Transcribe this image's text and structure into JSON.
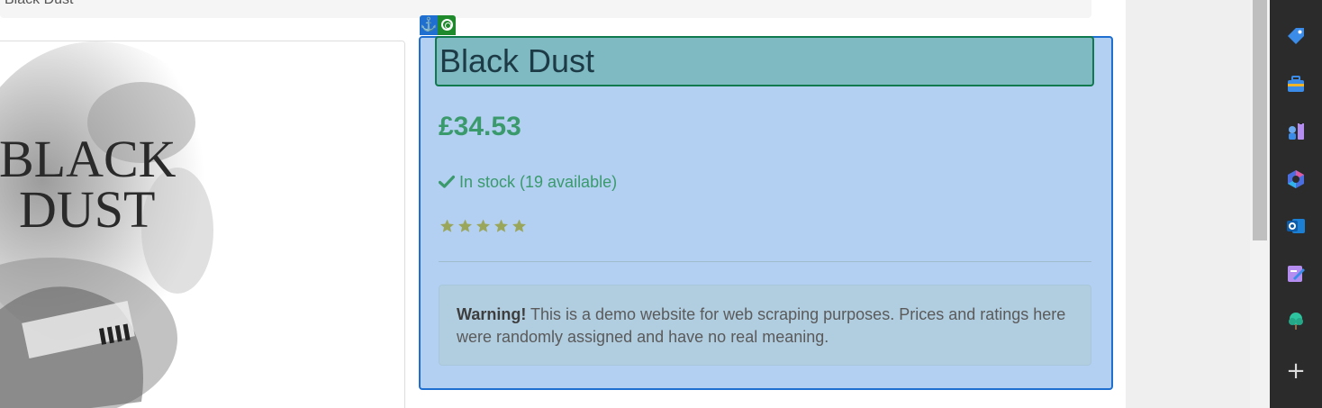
{
  "breadcrumb": {
    "current": "Black Dust"
  },
  "product": {
    "title": "Black Dust",
    "price": "£34.53",
    "availability": "In stock (19 available)",
    "rating": {
      "stars": 5,
      "max": 5
    },
    "image_caption_line1": "BLACK",
    "image_caption_line2": "DUST"
  },
  "alert": {
    "strong": "Warning!",
    "text": " This is a demo website for web scraping purposes. Prices and ratings here were randomly assigned and have no real meaning."
  },
  "inspector": {
    "anchor_icon": "anchor-icon",
    "target_icon": "target-icon"
  },
  "sidebar": {
    "items": [
      {
        "icon": "tag-icon"
      },
      {
        "icon": "briefcase-icon"
      },
      {
        "icon": "chess-icon"
      },
      {
        "icon": "copilot-icon"
      },
      {
        "icon": "outlook-icon"
      },
      {
        "icon": "designer-icon"
      },
      {
        "icon": "tree-icon"
      },
      {
        "icon": "add-icon",
        "label": "+"
      }
    ]
  },
  "colors": {
    "highlight_bg": "#b3d0f3",
    "highlight_border": "#1e6fd0",
    "title_box": "#7fb9c1",
    "price_green": "#3a9a6c",
    "star": "#9aa65a"
  }
}
